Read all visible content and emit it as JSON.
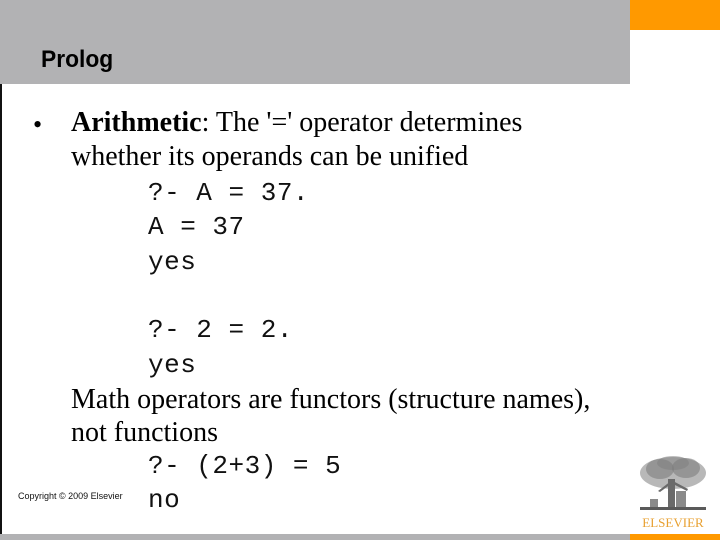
{
  "slide": {
    "title": "Prolog",
    "colors": {
      "header_gray": "#b2b2b4",
      "accent_orange": "#ff9900",
      "logo_orange": "#e8a030"
    },
    "bullet": {
      "symbol": "•",
      "term": "Arithmetic",
      "line1_rest": ": The '=' operator determines",
      "line2": "whether its operands can be unified"
    },
    "code_block_1": [
      "?- A = 37.",
      "A = 37",
      "yes"
    ],
    "code_block_2": [
      "?- 2 = 2.",
      "yes"
    ],
    "note_lines": [
      "Math operators are functors (structure names),",
      "not functions"
    ],
    "code_block_3": [
      "?- (2+3) = 5",
      "no"
    ],
    "footer": {
      "copyright": "Copyright © 2009 Elsevier",
      "logo_text": "ELSEVIER",
      "logo_icon": "elsevier-tree-icon"
    }
  }
}
